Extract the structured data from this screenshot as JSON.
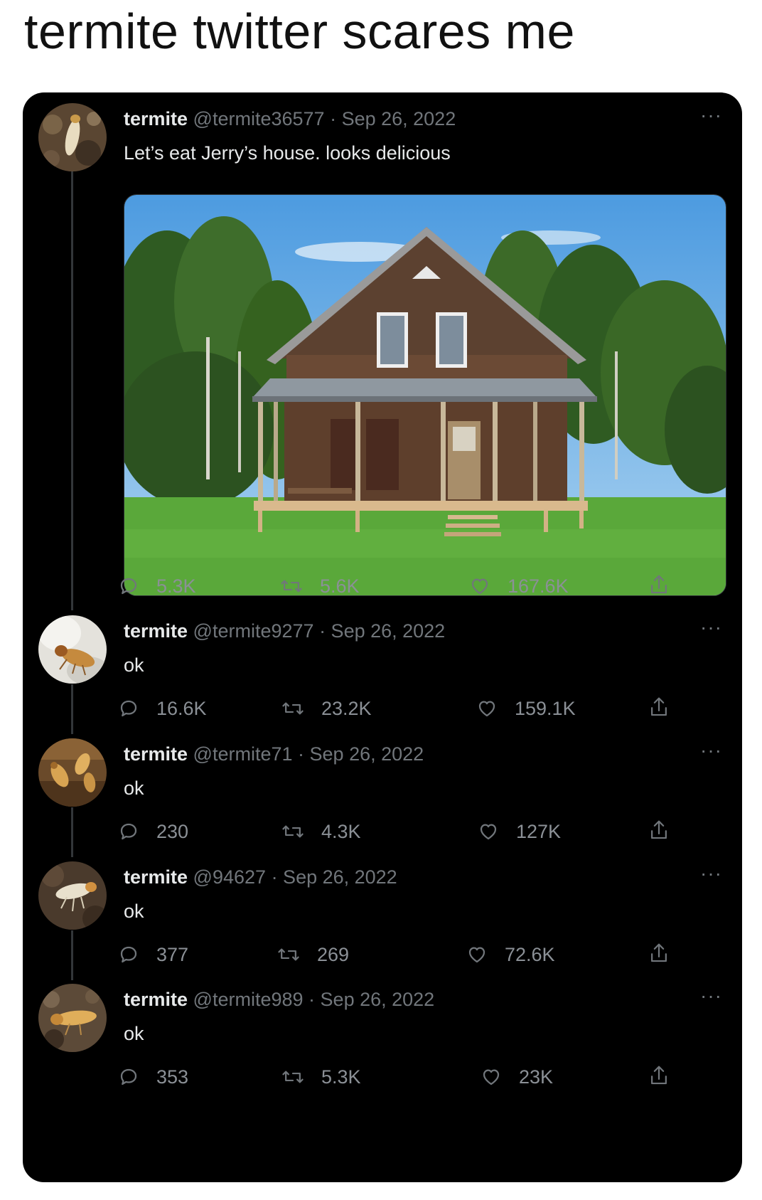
{
  "caption": "termite twitter scares me",
  "tweets": [
    {
      "name": "termite",
      "handle": "@termite36577",
      "date": "· Sep 26, 2022",
      "text": "Let’s eat Jerry’s house. looks delicious",
      "has_media": true,
      "replies": "5.3K",
      "retweets": "5.6K",
      "likes": "167.6K"
    },
    {
      "name": "termite",
      "handle": "@termite9277",
      "date": "· Sep 26, 2022",
      "text": "ok",
      "replies": "16.6K",
      "retweets": "23.2K",
      "likes": "159.1K"
    },
    {
      "name": "termite",
      "handle": "@termite71",
      "date": "· Sep 26, 2022",
      "text": "ok",
      "replies": "230",
      "retweets": "4.3K",
      "likes": "127K"
    },
    {
      "name": "termite",
      "handle": "@94627",
      "date": "· Sep 26, 2022",
      "text": "ok",
      "replies": "377",
      "retweets": "269",
      "likes": "72.6K"
    },
    {
      "name": "termite",
      "handle": "@termite989",
      "date": "· Sep 26, 2022",
      "text": "ok",
      "replies": "353",
      "retweets": "5.3K",
      "likes": "23K"
    }
  ],
  "more_glyph": "···",
  "icons": {
    "reply": "reply-icon",
    "retweet": "retweet-icon",
    "like": "heart-icon",
    "share": "share-icon",
    "more": "more-icon"
  },
  "colors": {
    "card_bg": "#000000",
    "primary_text": "#e7e9ea",
    "secondary_text": "#71767b",
    "thread_line": "#333639"
  }
}
